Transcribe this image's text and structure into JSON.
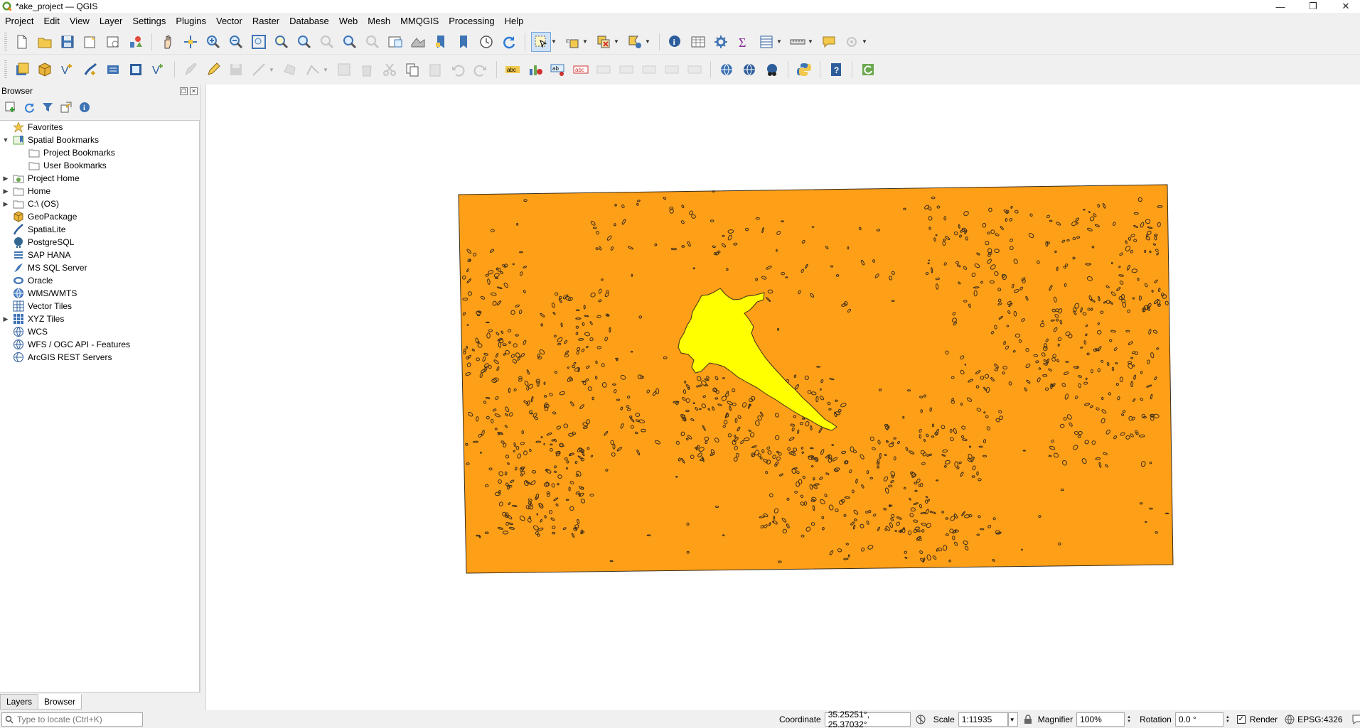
{
  "window": {
    "title": "*ake_project — QGIS",
    "controls": {
      "minimize": "—",
      "restore": "❐",
      "close": "✕"
    }
  },
  "menubar": {
    "items": [
      "Project",
      "Edit",
      "View",
      "Layer",
      "Settings",
      "Plugins",
      "Vector",
      "Raster",
      "Database",
      "Web",
      "Mesh",
      "MMQGIS",
      "Processing",
      "Help"
    ]
  },
  "toolbar1": {
    "icons": [
      "new-project-icon",
      "open-project-icon",
      "save-project-icon",
      "new-print-layout-icon",
      "layout-manager-icon",
      "style-manager-icon",
      "pan-icon",
      "pan-to-selection-icon",
      "zoom-in-icon",
      "zoom-out-icon",
      "zoom-full-icon",
      "zoom-to-selection-icon",
      "zoom-to-layer-icon",
      "zoom-native-icon",
      "zoom-last-icon",
      "zoom-next-icon",
      "new-map-view-icon",
      "new-3d-map-icon",
      "new-bookmark-icon",
      "show-bookmarks-icon",
      "temporal-controller-icon",
      "refresh-icon",
      "select-features-icon",
      "select-by-expression-icon",
      "deselect-icon",
      "select-by-location-icon",
      "identify-icon",
      "attribute-table-icon",
      "processing-toolbox-icon",
      "statistics-icon",
      "open-attribute-table-icon",
      "measure-icon",
      "map-tips-icon",
      "gps-icon"
    ]
  },
  "toolbar2": {
    "icons": [
      "data-source-manager-icon",
      "new-geopackage-layer-icon",
      "new-shapefile-layer-icon",
      "new-spatialite-layer-icon",
      "new-temporary-layer-icon",
      "new-virtual-layer-icon",
      "add-vector-layer-icon",
      "current-edits-icon",
      "toggle-editing-icon",
      "save-edits-icon",
      "digitize-icon",
      "add-polygon-icon",
      "vertex-tool-icon",
      "modify-attributes-icon",
      "delete-selected-icon",
      "cut-features-icon",
      "copy-features-icon",
      "paste-features-icon",
      "undo-icon",
      "redo-icon",
      "label-toolbar-icon",
      "diagram-icon",
      "pin-label-icon",
      "highlight-label-icon",
      "show-hide-labels-icon",
      "move-label-icon",
      "rotate-label-icon",
      "change-label-icon",
      "wms-layer-icon",
      "wfs-layer-icon",
      "metasearch-icon",
      "python-console-icon",
      "help-icon",
      "plugin-reloader-icon"
    ]
  },
  "browser_panel": {
    "title": "Browser",
    "tools": [
      "add-selected-icon",
      "refresh-browser-icon",
      "filter-browser-icon",
      "collapse-all-icon",
      "enable-properties-icon"
    ],
    "tree": [
      {
        "label": "Favorites",
        "icon": "star-icon",
        "expand": "",
        "indent": 0
      },
      {
        "label": "Spatial Bookmarks",
        "icon": "bookmark-icon",
        "expand": "▼",
        "indent": 0
      },
      {
        "label": "Project Bookmarks",
        "icon": "folder-icon",
        "expand": "",
        "indent": 1
      },
      {
        "label": "User Bookmarks",
        "icon": "folder-icon",
        "expand": "",
        "indent": 1
      },
      {
        "label": "Project Home",
        "icon": "project-home-icon",
        "expand": "▶",
        "indent": 0
      },
      {
        "label": "Home",
        "icon": "folder-icon",
        "expand": "▶",
        "indent": 0
      },
      {
        "label": "C:\\ (OS)",
        "icon": "folder-icon",
        "expand": "▶",
        "indent": 0
      },
      {
        "label": "GeoPackage",
        "icon": "geopackage-icon",
        "expand": "",
        "indent": 0
      },
      {
        "label": "SpatiaLite",
        "icon": "spatialite-icon",
        "expand": "",
        "indent": 0
      },
      {
        "label": "PostgreSQL",
        "icon": "postgresql-icon",
        "expand": "",
        "indent": 0
      },
      {
        "label": "SAP HANA",
        "icon": "sap-hana-icon",
        "expand": "",
        "indent": 0
      },
      {
        "label": "MS SQL Server",
        "icon": "mssql-icon",
        "expand": "",
        "indent": 0
      },
      {
        "label": "Oracle",
        "icon": "oracle-icon",
        "expand": "",
        "indent": 0
      },
      {
        "label": "WMS/WMTS",
        "icon": "wms-icon",
        "expand": "",
        "indent": 0
      },
      {
        "label": "Vector Tiles",
        "icon": "vector-tiles-icon",
        "expand": "",
        "indent": 0
      },
      {
        "label": "XYZ Tiles",
        "icon": "xyz-tiles-icon",
        "expand": "▶",
        "indent": 0
      },
      {
        "label": "WCS",
        "icon": "wcs-icon",
        "expand": "",
        "indent": 0
      },
      {
        "label": "WFS / OGC API - Features",
        "icon": "wfs-icon",
        "expand": "",
        "indent": 0
      },
      {
        "label": "ArcGIS REST Servers",
        "icon": "arcgis-icon",
        "expand": "",
        "indent": 0
      }
    ]
  },
  "bottom_tabs": [
    "Layers",
    "Browser"
  ],
  "map": {
    "colors": {
      "background": "#ffffff",
      "land": "#fe9f18",
      "lake": "#ffff00",
      "outline": "#3a2d1a"
    }
  },
  "statusbar": {
    "locator_placeholder": "Type to locate (Ctrl+K)",
    "coordinate_label": "Coordinate",
    "coordinate_value": "35.25251°, 25.37032°",
    "scale_label": "Scale",
    "scale_value": "1:11935",
    "magnifier_label": "Magnifier",
    "magnifier_value": "100%",
    "rotation_label": "Rotation",
    "rotation_value": "0.0 °",
    "render_label": "Render",
    "render_checked": "✓",
    "crs": "EPSG:4326"
  }
}
